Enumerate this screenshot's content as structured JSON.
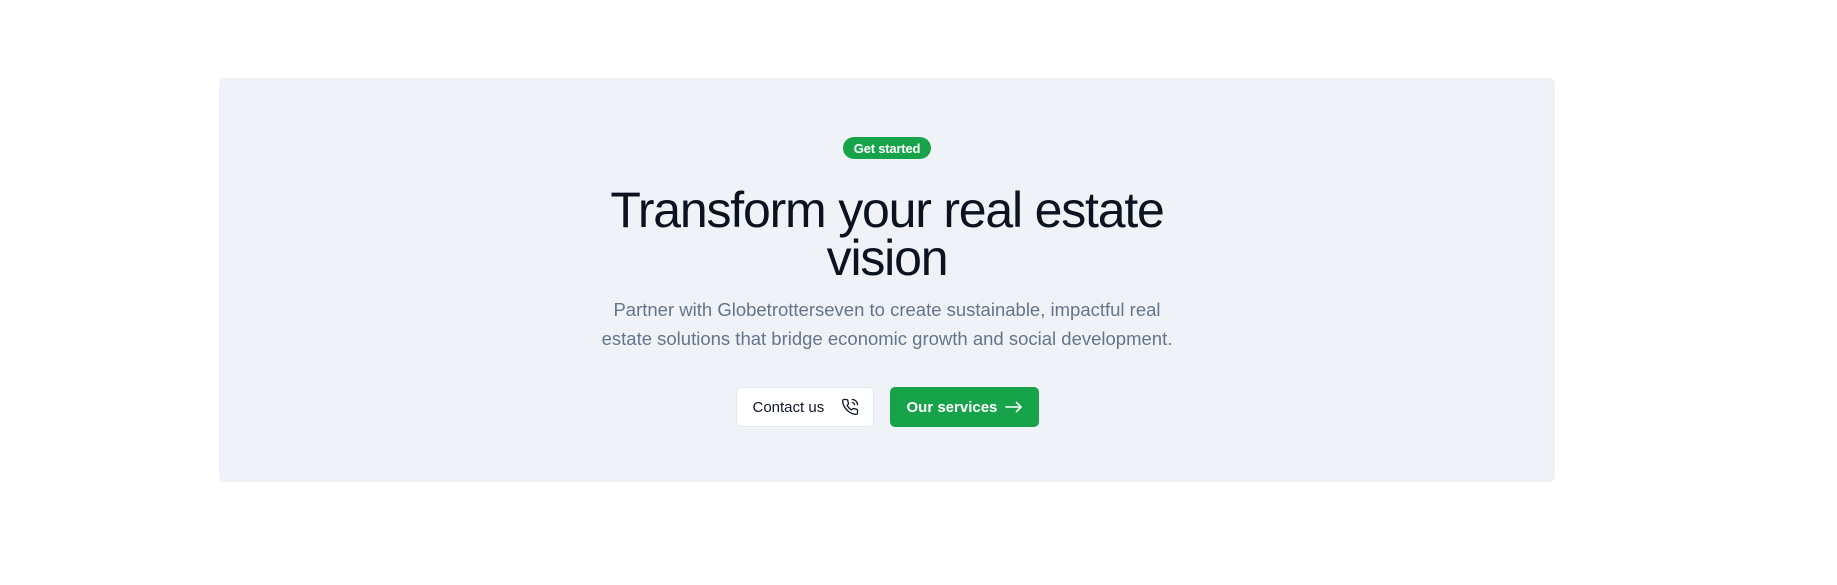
{
  "cta": {
    "badge": "Get started",
    "title": "Transform your real estate vision",
    "description": "Partner with Globetrotterseven to create sustainable, impactful real estate solutions that bridge economic growth and social development.",
    "contact_label": "Contact us",
    "contact_icon": "phone-icon",
    "services_label": "Our services",
    "services_icon": "arrow-right-icon"
  },
  "colors": {
    "accent": "#16a34a",
    "card_background": "#eff3f8",
    "heading": "#0b1220",
    "body_text": "#64748b"
  }
}
